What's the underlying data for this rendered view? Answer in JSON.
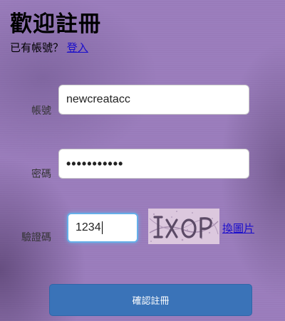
{
  "header": {
    "title": "歡迎註冊",
    "login_prompt": "已有帳號？",
    "login_link": "登入"
  },
  "form": {
    "account": {
      "label": "帳號",
      "value": "newcreatacc"
    },
    "password": {
      "label": "密碼",
      "masked_value": "•••••••••••"
    },
    "captcha": {
      "label": "驗證碼",
      "value": "1234",
      "image_icon": "captcha-image",
      "refresh_link": "換圖片"
    },
    "submit_label": "確認註冊"
  },
  "colors": {
    "background": "#9a7cbc",
    "link": "#1a0dcc",
    "button": "#3a73b8",
    "focus": "#66afe9"
  }
}
